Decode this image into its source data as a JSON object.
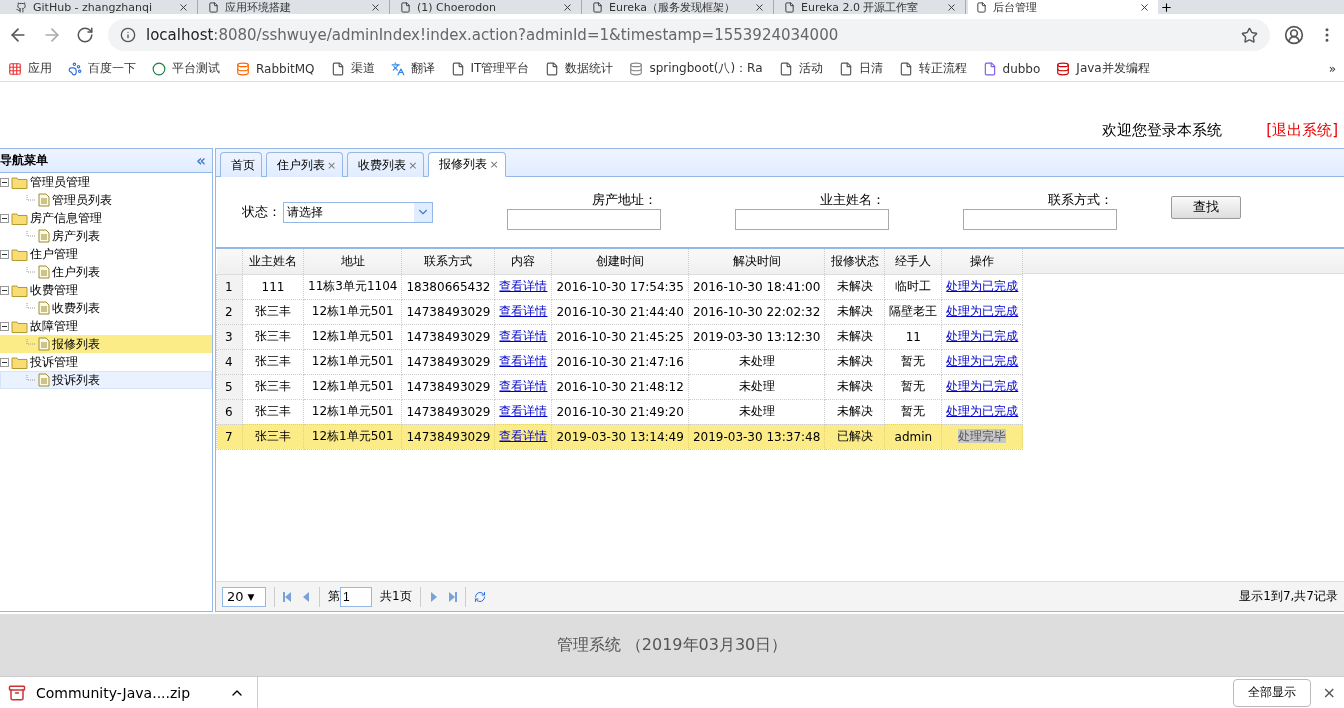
{
  "browser": {
    "tabs": [
      {
        "title": "GitHub - zhangzhanqi",
        "selected": false
      },
      {
        "title": "应用环境搭建",
        "selected": false
      },
      {
        "title": "(1) Choerodon",
        "selected": false
      },
      {
        "title": "Eureka（服务发现框架）",
        "selected": false
      },
      {
        "title": "Eureka 2.0 开源工作室",
        "selected": false
      },
      {
        "title": "后台管理",
        "selected": true
      }
    ],
    "url_host": "localhost",
    "url_rest": ":8080/sshwuye/adminIndex!index.action?adminId=1&timestamp=1553924034000",
    "bookmarks": [
      "应用",
      "百度一下",
      "平台测试",
      "RabbitMQ",
      "渠道",
      "翻译",
      "IT管理平台",
      "数据统计",
      "springboot(八)：Ra",
      "活动",
      "日清",
      "转正流程",
      "dubbo",
      "Java并发编程"
    ],
    "more": "»"
  },
  "header": {
    "welcome": "欢迎您登录本系统",
    "logout": "[退出系统]"
  },
  "sidebar": {
    "title": "导航菜单",
    "collapse": "«",
    "groups": [
      {
        "label": "管理员管理",
        "expanded": true,
        "children": [
          {
            "label": "管理员列表",
            "selected": false,
            "hovered": false
          }
        ]
      },
      {
        "label": "房产信息管理",
        "expanded": true,
        "children": [
          {
            "label": "房产列表",
            "selected": false,
            "hovered": false
          }
        ]
      },
      {
        "label": "住户管理",
        "expanded": true,
        "children": [
          {
            "label": "住户列表",
            "selected": false,
            "hovered": false
          }
        ]
      },
      {
        "label": "收费管理",
        "expanded": true,
        "children": [
          {
            "label": "收费列表",
            "selected": false,
            "hovered": false
          }
        ]
      },
      {
        "label": "故障管理",
        "expanded": true,
        "children": [
          {
            "label": "报修列表",
            "selected": true,
            "hovered": false
          }
        ]
      },
      {
        "label": "投诉管理",
        "expanded": true,
        "children": [
          {
            "label": "投诉列表",
            "selected": false,
            "hovered": true
          }
        ]
      }
    ]
  },
  "tabs": [
    {
      "label": "首页",
      "closable": false,
      "selected": false
    },
    {
      "label": "住户列表",
      "closable": true,
      "selected": false
    },
    {
      "label": "收费列表",
      "closable": true,
      "selected": false
    },
    {
      "label": "报修列表",
      "closable": true,
      "selected": true
    }
  ],
  "close_mark": "×",
  "filters": {
    "status": {
      "label": "状态：",
      "value": "请选择"
    },
    "fields": [
      {
        "label": "房产地址："
      },
      {
        "label": "业主姓名："
      },
      {
        "label": "联系方式："
      }
    ],
    "search": "查找"
  },
  "table": {
    "columns": [
      "业主姓名",
      "地址",
      "联系方式",
      "内容",
      "创建时间",
      "解决时间",
      "报修状态",
      "经手人",
      "操作"
    ],
    "rows": [
      {
        "index": "1",
        "cells": [
          "111",
          "11栋3单元1104",
          "18380665432",
          "查看详情",
          "2016-10-30 17:54:35",
          "2016-10-30 18:41:00",
          "未解决",
          "临时工"
        ],
        "action": {
          "label": "处理为已完成",
          "kind": "link"
        },
        "selected": false
      },
      {
        "index": "2",
        "cells": [
          "张三丰",
          "12栋1单元501",
          "14738493029",
          "查看详情",
          "2016-10-30 21:44:40",
          "2016-10-30 22:02:32",
          "未解决",
          "隔壁老王"
        ],
        "action": {
          "label": "处理为已完成",
          "kind": "link"
        },
        "selected": false
      },
      {
        "index": "3",
        "cells": [
          "张三丰",
          "12栋1单元501",
          "14738493029",
          "查看详情",
          "2016-10-30 21:45:25",
          "2019-03-30 13:12:30",
          "未解决",
          "11"
        ],
        "action": {
          "label": "处理为已完成",
          "kind": "link"
        },
        "selected": false
      },
      {
        "index": "4",
        "cells": [
          "张三丰",
          "12栋1单元501",
          "14738493029",
          "查看详情",
          "2016-10-30 21:47:16",
          "未处理",
          "未解决",
          "暂无"
        ],
        "action": {
          "label": "处理为已完成",
          "kind": "link"
        },
        "selected": false
      },
      {
        "index": "5",
        "cells": [
          "张三丰",
          "12栋1单元501",
          "14738493029",
          "查看详情",
          "2016-10-30 21:48:12",
          "未处理",
          "未解决",
          "暂无"
        ],
        "action": {
          "label": "处理为已完成",
          "kind": "link"
        },
        "selected": false
      },
      {
        "index": "6",
        "cells": [
          "张三丰",
          "12栋1单元501",
          "14738493029",
          "查看详情",
          "2016-10-30 21:49:20",
          "未处理",
          "未解决",
          "暂无"
        ],
        "action": {
          "label": "处理为已完成",
          "kind": "link"
        },
        "selected": false
      },
      {
        "index": "7",
        "cells": [
          "张三丰",
          "12栋1单元501",
          "14738493029",
          "查看详情",
          "2019-03-30 13:14:49",
          "2019-03-30 13:37:48",
          "已解决",
          "admin"
        ],
        "action": {
          "label": "处理完毕",
          "kind": "done"
        },
        "selected": true
      }
    ]
  },
  "pager": {
    "page_size": "20",
    "page_size_caret": "▼",
    "page_prefix": "第",
    "page": "1",
    "page_total": "共1页",
    "summary": "显示1到7,共7记录"
  },
  "footer": "管理系统 （2019年03月30日）",
  "downloads": {
    "file": "Community-Java....zip",
    "show_all": "全部显示",
    "close": "×"
  }
}
